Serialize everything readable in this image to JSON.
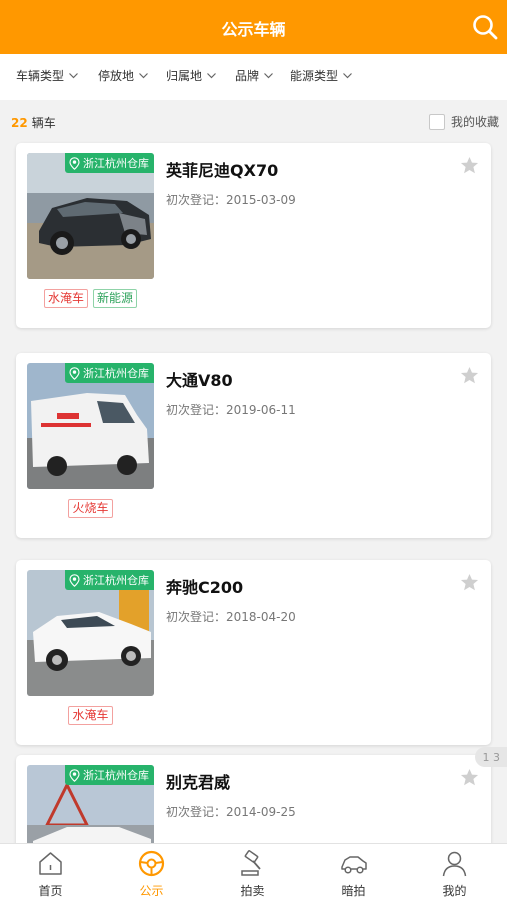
{
  "colors": {
    "accent": "#ff9800",
    "location_badge": "#27b36b",
    "tag_red": "#e53935",
    "tag_green": "#2fa35c"
  },
  "header": {
    "title": "公示车辆",
    "search_icon": "search-icon"
  },
  "filters": [
    "车辆类型",
    "停放地",
    "归属地",
    "品牌",
    "能源类型"
  ],
  "summary": {
    "count": "22",
    "count_unit": "辆车",
    "favorites_label": "我的收藏"
  },
  "vehicles": [
    {
      "location": "浙江杭州仓库",
      "name": "英菲尼迪QX70",
      "registration": "初次登记：2015-03-09",
      "tags": [
        {
          "text": "水淹车",
          "type": "red"
        },
        {
          "text": "新能源",
          "type": "green"
        }
      ]
    },
    {
      "location": "浙江杭州仓库",
      "name": "大通V80",
      "registration": "初次登记：2019-06-11",
      "tags": [
        {
          "text": "火烧车",
          "type": "red"
        }
      ]
    },
    {
      "location": "浙江杭州仓库",
      "name": "奔驰C200",
      "registration": "初次登记：2018-04-20",
      "tags": [
        {
          "text": "水淹车",
          "type": "red"
        }
      ]
    },
    {
      "location": "浙江杭州仓库",
      "name": "别克君威",
      "registration": "初次登记：2014-09-25",
      "tags": []
    }
  ],
  "pager": "1 3",
  "tabbar": [
    {
      "label": "首页",
      "icon": "home-icon",
      "active": false
    },
    {
      "label": "公示",
      "icon": "steering-wheel-icon",
      "active": true
    },
    {
      "label": "拍卖",
      "icon": "gavel-icon",
      "active": false
    },
    {
      "label": "暗拍",
      "icon": "car-icon",
      "active": false
    },
    {
      "label": "我的",
      "icon": "user-icon",
      "active": false
    }
  ]
}
